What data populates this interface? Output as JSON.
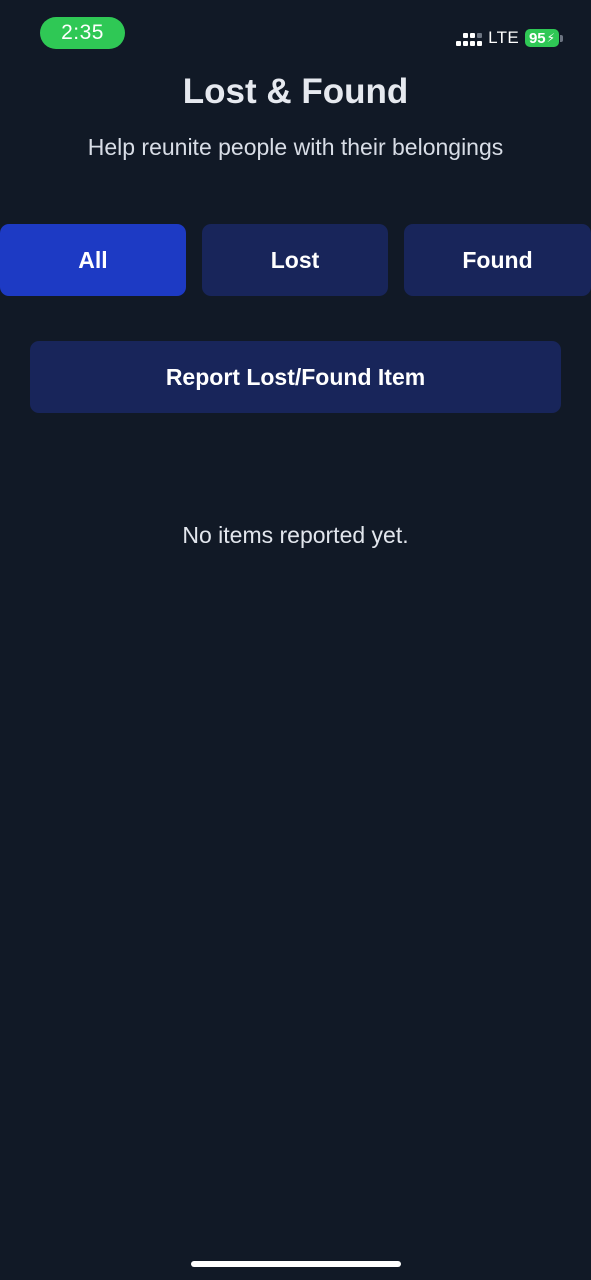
{
  "status_bar": {
    "time": "2:35",
    "network": "LTE",
    "battery": "95",
    "icons": [
      "signal-icon",
      "battery-charging-icon"
    ]
  },
  "header": {
    "title": "Lost & Found",
    "subtitle": "Help reunite people with their belongings"
  },
  "filters": {
    "selected": "All",
    "tabs": [
      {
        "label": "All"
      },
      {
        "label": "Lost"
      },
      {
        "label": "Found"
      }
    ]
  },
  "actions": {
    "report_label": "Report Lost/Found Item"
  },
  "list": {
    "empty_message": "No items reported yet."
  },
  "colors": {
    "background": "#111926",
    "tab_active": "#1d3ac4",
    "tab_inactive": "#18255a",
    "status_green": "#2fc855"
  }
}
